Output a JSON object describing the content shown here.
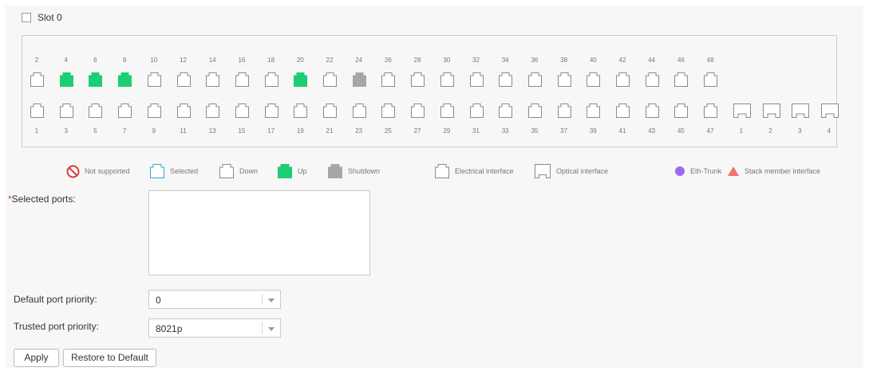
{
  "slot": {
    "label": "Slot 0",
    "checked": false
  },
  "ports": {
    "top_row_numbers": [
      "2",
      "4",
      "6",
      "8",
      "10",
      "12",
      "14",
      "16",
      "18",
      "20",
      "22",
      "24",
      "26",
      "28",
      "30",
      "32",
      "34",
      "36",
      "38",
      "40",
      "42",
      "44",
      "46",
      "48"
    ],
    "top_row_states": [
      "down",
      "up",
      "up",
      "up",
      "down",
      "down",
      "down",
      "down",
      "down",
      "up",
      "down",
      "shutdown",
      "down",
      "down",
      "down",
      "down",
      "down",
      "down",
      "down",
      "down",
      "down",
      "down",
      "down",
      "down"
    ],
    "bottom_row_numbers": [
      "1",
      "3",
      "5",
      "7",
      "9",
      "11",
      "13",
      "15",
      "17",
      "19",
      "21",
      "23",
      "25",
      "27",
      "29",
      "31",
      "33",
      "35",
      "37",
      "39",
      "41",
      "43",
      "45",
      "47"
    ],
    "optical_numbers": [
      "1",
      "2",
      "3",
      "4"
    ]
  },
  "legend": {
    "not_supported": "Not supported",
    "selected": "Selected",
    "down": "Down",
    "up": "Up",
    "shutdown": "Shutdown",
    "electrical": "Electrical interface",
    "optical": "Optical interface",
    "eth_trunk": "Eth-Trunk",
    "stack_member": "Stack member interface"
  },
  "form": {
    "required_mark": "*",
    "selected_ports_label": "Selected ports:",
    "selected_ports_value": "",
    "default_priority_label": "Default port priority:",
    "default_priority_value": "0",
    "trusted_priority_label": "Trusted port priority:",
    "trusted_priority_value": "8021p"
  },
  "buttons": {
    "apply": "Apply",
    "restore": "Restore to Default"
  },
  "colors": {
    "up": "#1bcd75",
    "shutdown": "#a6a6a6",
    "down_border": "#8a8a8a",
    "selected_border": "#2fa5dc",
    "not_supported": "#d93a3a",
    "eth_trunk": "#9b6cf2",
    "stack_member": "#f2716b"
  }
}
